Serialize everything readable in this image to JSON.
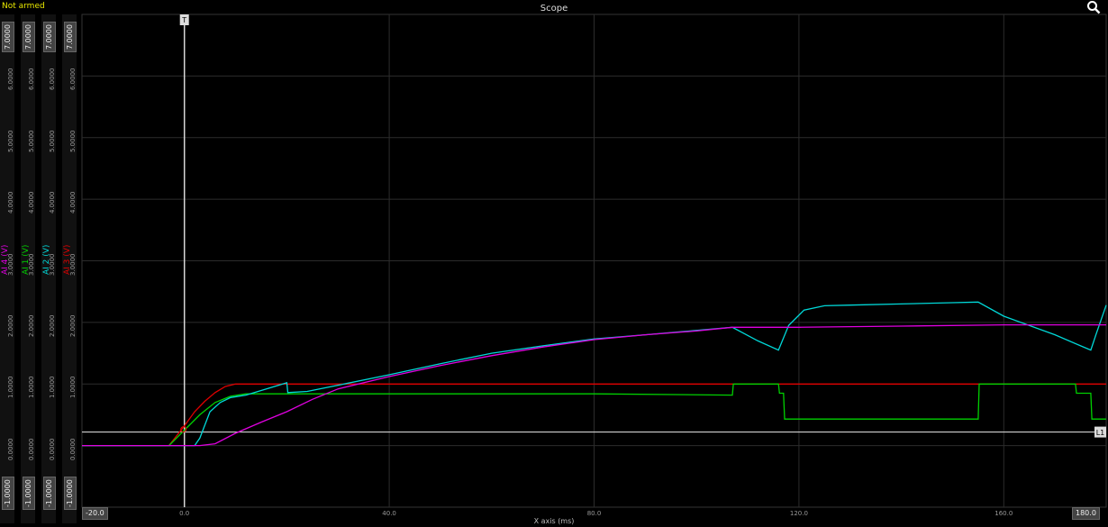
{
  "status": "Not armed",
  "title": "Scope",
  "icons": {
    "search": "magnifier-icon",
    "trigger_marker": "T",
    "level_marker": "L1"
  },
  "y_axes": [
    {
      "name": "AI 4 (V)",
      "color": "#e000e0",
      "max_label": "7.0000",
      "min_label": "-1.0000",
      "ticks": [
        "6.0000",
        "5.0000",
        "4.0000",
        "3.0000",
        "2.0000",
        "1.0000",
        "0.0000"
      ]
    },
    {
      "name": "AI 1 (V)",
      "color": "#00d000",
      "max_label": "7.0000",
      "min_label": "-1.0000",
      "ticks": [
        "6.0000",
        "5.0000",
        "4.0000",
        "3.0000",
        "2.0000",
        "1.0000",
        "0.0000"
      ]
    },
    {
      "name": "AI 2 (V)",
      "color": "#00d8d8",
      "max_label": "7.0000",
      "min_label": "-1.0000",
      "ticks": [
        "6.0000",
        "5.0000",
        "4.0000",
        "3.0000",
        "2.0000",
        "1.0000",
        "0.0000"
      ]
    },
    {
      "name": "AI 3 (V)",
      "color": "#e00000",
      "max_label": "7.0000",
      "min_label": "-1.0000",
      "ticks": [
        "6.0000",
        "5.0000",
        "4.0000",
        "3.0000",
        "2.0000",
        "1.0000",
        "0.0000"
      ]
    }
  ],
  "x_axis": {
    "label": "X axis (ms)",
    "min_label": "-20.0",
    "max_label": "180.0",
    "ticks": [
      "0.0",
      "40.0",
      "80.0",
      "120.0",
      "160.0"
    ]
  },
  "chart_data": {
    "type": "line",
    "title": "Scope",
    "xlabel": "X axis (ms)",
    "ylabel": "",
    "xlim": [
      -20,
      180
    ],
    "ylim": [
      -1,
      7
    ],
    "grid": true,
    "trigger_x": 0,
    "level_y": 0.22,
    "series": [
      {
        "name": "AI 3 (V)",
        "color": "#e00000",
        "x": [
          -20,
          -3,
          0,
          2,
          4,
          6,
          8,
          10,
          180
        ],
        "y": [
          0,
          0,
          0.32,
          0.55,
          0.72,
          0.86,
          0.96,
          1.0,
          1.0
        ]
      },
      {
        "name": "AI 1 (V)",
        "color": "#00d000",
        "x": [
          -20,
          -3,
          0,
          3,
          6,
          9,
          12,
          20,
          40,
          80,
          107,
          107.2,
          116,
          116.2,
          117,
          117.2,
          155,
          155.2,
          174,
          174.2,
          177,
          177.2,
          180
        ],
        "y": [
          0,
          0,
          0.25,
          0.5,
          0.7,
          0.8,
          0.84,
          0.84,
          0.84,
          0.84,
          0.82,
          1.0,
          1.0,
          0.85,
          0.85,
          0.43,
          0.43,
          1.0,
          1.0,
          0.85,
          0.85,
          0.43,
          0.43
        ]
      },
      {
        "name": "AI 2 (V)",
        "color": "#00d8d8",
        "x": [
          -20,
          2,
          3,
          5,
          7,
          9,
          12,
          16,
          20,
          20.2,
          24,
          30,
          40,
          50,
          60,
          70,
          80,
          90,
          100,
          107,
          112,
          116,
          118,
          121,
          125,
          130,
          140,
          150,
          155,
          160,
          165,
          170,
          175,
          177,
          178,
          180
        ],
        "y": [
          0,
          0,
          0.12,
          0.55,
          0.7,
          0.78,
          0.82,
          0.92,
          1.02,
          0.86,
          0.88,
          0.98,
          1.15,
          1.33,
          1.5,
          1.62,
          1.73,
          1.8,
          1.87,
          1.92,
          1.7,
          1.55,
          1.95,
          2.2,
          2.27,
          2.28,
          2.3,
          2.32,
          2.33,
          2.1,
          1.95,
          1.8,
          1.62,
          1.55,
          1.8,
          2.28
        ]
      },
      {
        "name": "AI 4 (V)",
        "color": "#e000e0",
        "x": [
          -20,
          3,
          6,
          10,
          15,
          20,
          25,
          30,
          40,
          50,
          60,
          70,
          80,
          90,
          100,
          107,
          120,
          140,
          160,
          180
        ],
        "y": [
          0,
          0,
          0.03,
          0.2,
          0.38,
          0.55,
          0.75,
          0.92,
          1.12,
          1.3,
          1.46,
          1.6,
          1.72,
          1.8,
          1.86,
          1.92,
          1.92,
          1.94,
          1.96,
          1.96
        ]
      }
    ]
  }
}
